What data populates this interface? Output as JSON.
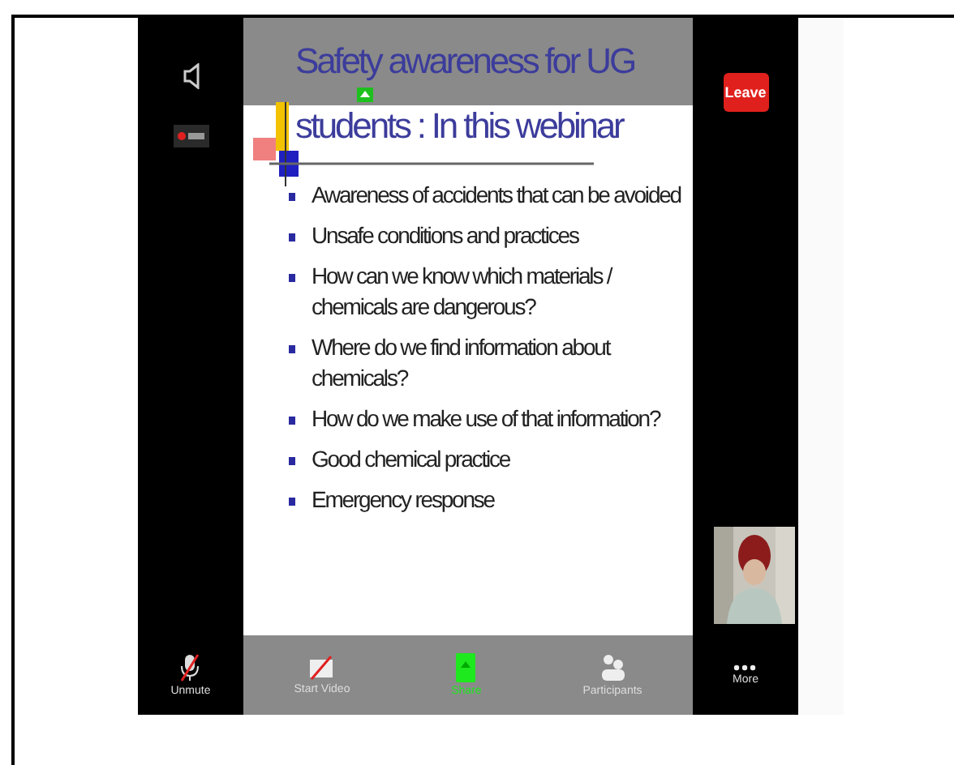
{
  "slide": {
    "title_lines": [
      "Safety awareness for UG",
      "students : In this webinar"
    ],
    "bullets": [
      [
        "Awareness of accidents that can be avoided"
      ],
      [
        "Unsafe conditions and practices"
      ],
      [
        "How can we know which materials /",
        "chemicals are dangerous?"
      ],
      [
        "Where do we find information about",
        "chemicals?"
      ],
      [
        "How do we make use of that information?"
      ],
      [
        "Good chemical practice"
      ],
      [
        "Emergency response"
      ]
    ]
  },
  "leave_button": "Leave",
  "toolbar": [
    {
      "kind": "mic",
      "label": "Unmute",
      "active": false
    },
    {
      "kind": "video",
      "label": "Start Video",
      "active": false
    },
    {
      "kind": "share",
      "label": "Share",
      "active": true
    },
    {
      "kind": "participants",
      "label": "Participants",
      "active": false
    },
    {
      "kind": "more",
      "label": "More",
      "active": false
    }
  ]
}
